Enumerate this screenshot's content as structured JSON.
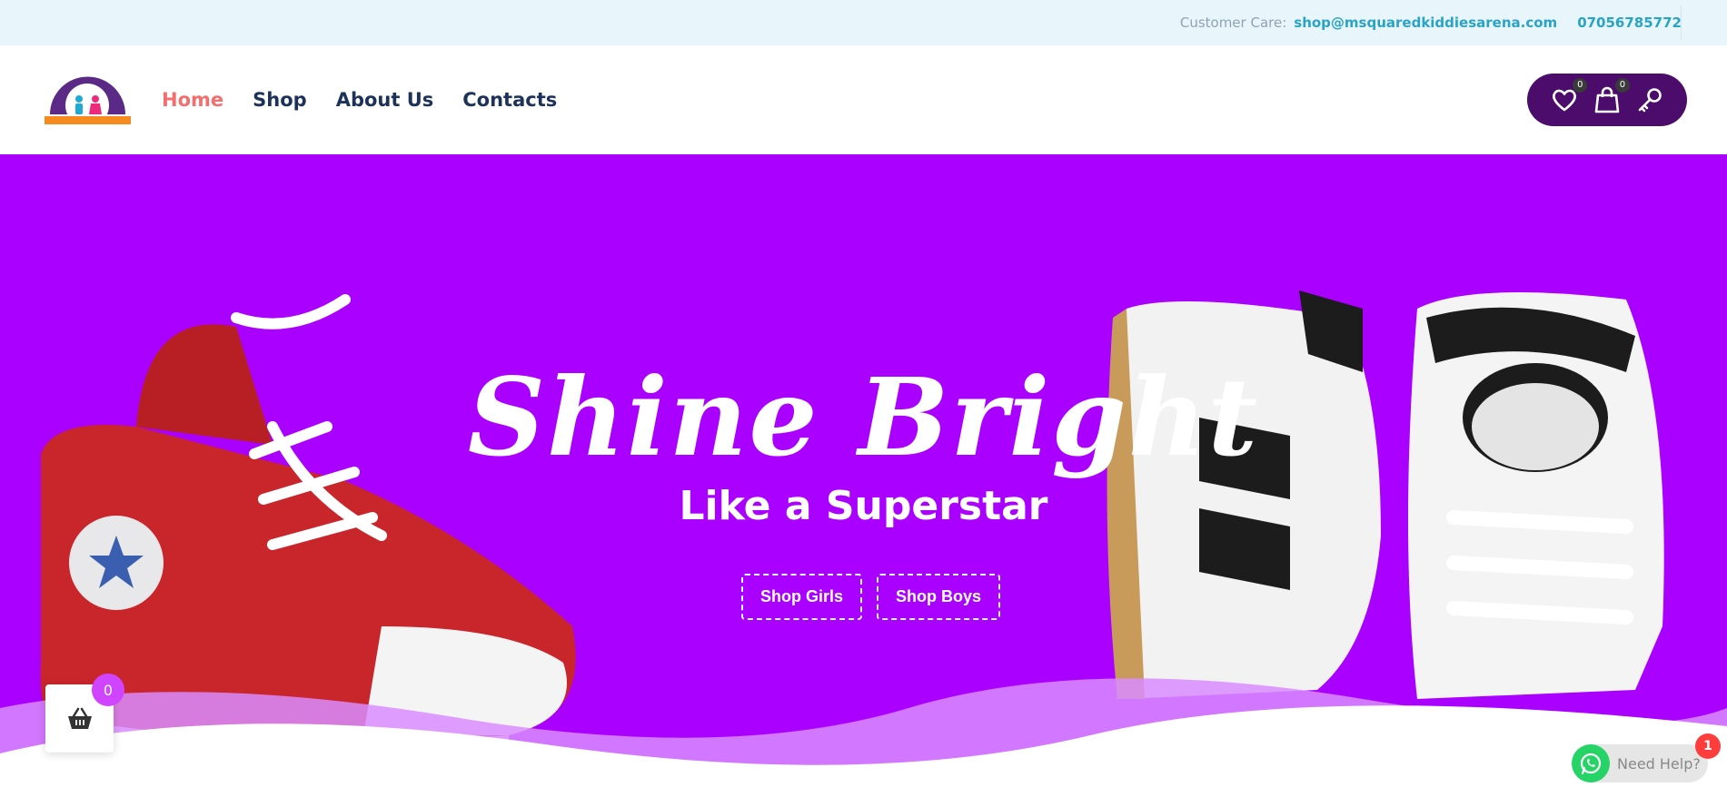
{
  "topbar": {
    "care_label": "Customer Care:",
    "email": "shop@msquaredkiddiesarena.com",
    "phone": "07056785772"
  },
  "header": {
    "logo_icon": "msquared-kiddies-arena-logo",
    "nav": [
      {
        "label": "Home",
        "active": true
      },
      {
        "label": "Shop"
      },
      {
        "label": "About Us"
      },
      {
        "label": "Contacts"
      }
    ],
    "wishlist_count": "0",
    "cart_count": "0",
    "icons": [
      "heart-icon",
      "shopping-bag-icon",
      "key-icon"
    ]
  },
  "hero": {
    "headline": "Shine Bright",
    "subline": "Like a Superstar",
    "buttons": {
      "girls": "Shop Girls",
      "boys": "Shop Boys"
    }
  },
  "floating_cart": {
    "count": "0",
    "icon": "basket-icon"
  },
  "whatsapp": {
    "label": "Need Help?",
    "badge": "1",
    "icon": "whatsapp-icon"
  },
  "colors": {
    "topbar_bg": "#e8f5fb",
    "accent_link": "#2aa3c4",
    "nav_active": "#f36f6f",
    "nav_text": "#1c3258",
    "pill_bg": "#4b0c6b",
    "hero_bg": "#aa00ff",
    "cart_badge": "#d144ff",
    "whatsapp_green": "#25d366"
  }
}
